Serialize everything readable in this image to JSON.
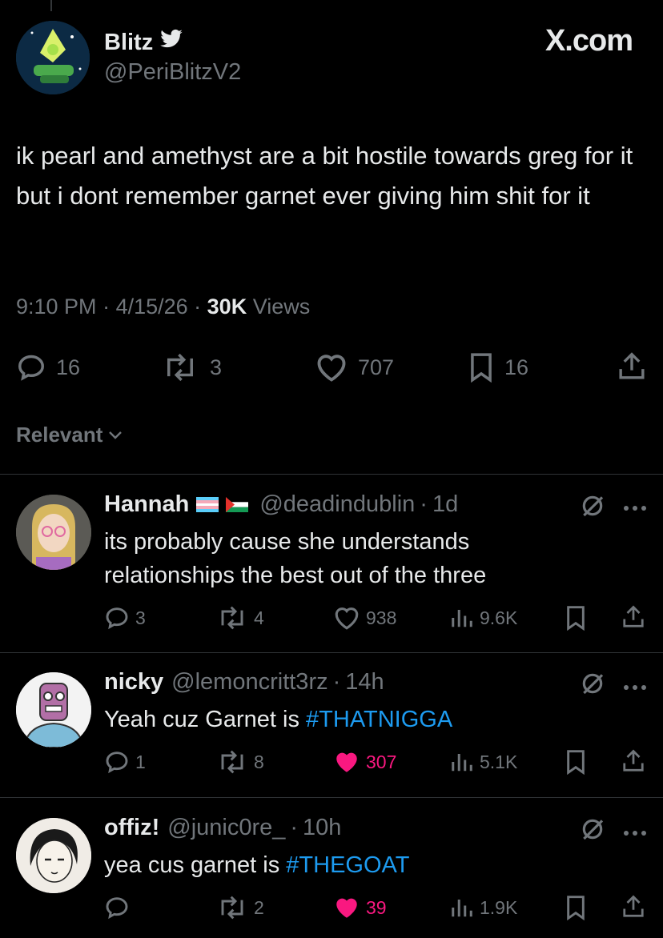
{
  "tweet": {
    "name": "Blitz",
    "handle": "@PeriBlitzV2",
    "brand": "X.com",
    "text": "ik pearl and amethyst are a bit hostile towards greg for it but i dont remember garnet ever giving him shit for it",
    "time": "9:10 PM",
    "date": "4/15/26",
    "views_count": "30K",
    "views_label": "Views",
    "stats": {
      "replies": "16",
      "reposts": "3",
      "likes": "707",
      "bookmarks": "16"
    }
  },
  "sort_label": "Relevant",
  "replies": [
    {
      "name": "Hannah",
      "handle": "@deadindublin",
      "time": "1d",
      "text_line1": "its probably cause she understands",
      "text_line2": "relationships the best out of the three",
      "replies": "3",
      "reposts": "4",
      "likes": "938",
      "views": "9.6K",
      "liked": false
    },
    {
      "name": "nicky",
      "handle": "@lemoncritt3rz",
      "time": "14h",
      "text_plain": "Yeah cuz Garnet is ",
      "hashtag": "#THATNIGGA",
      "replies": "1",
      "reposts": "8",
      "likes": "307",
      "views": "5.1K",
      "liked": true
    },
    {
      "name": "offiz!",
      "handle": "@junic0re_",
      "time": "10h",
      "text_plain": "yea cus garnet is ",
      "hashtag": "#THEGOAT",
      "replies": "",
      "reposts": "2",
      "likes": "39",
      "views": "1.9K",
      "liked": true
    }
  ],
  "colors": {
    "accent": "#1d9bf0",
    "like": "#f91880",
    "muted": "#71767b",
    "text": "#e7e9ea"
  },
  "icons": [
    "verified-bird-icon",
    "reply-icon",
    "repost-icon",
    "like-icon",
    "bookmark-icon",
    "share-icon",
    "views-icon",
    "grok-icon",
    "more-icon",
    "chevron-down-icon"
  ]
}
